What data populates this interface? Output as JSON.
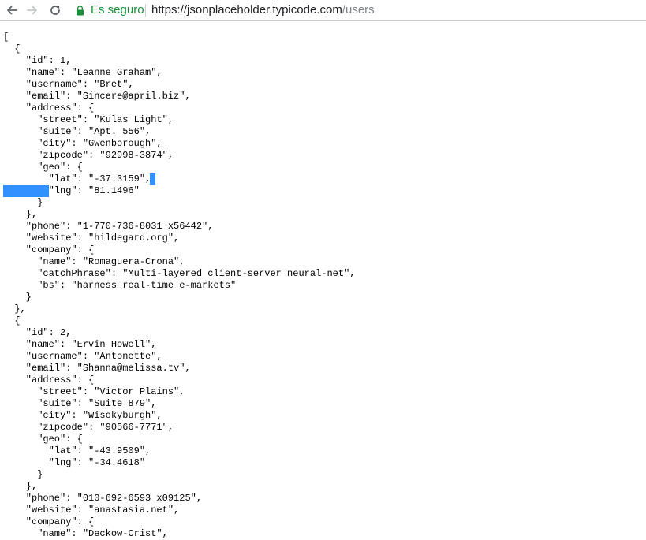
{
  "browser": {
    "security_label": "Es seguro",
    "url_scheme_host": "https://jsonplaceholder.typicode.com",
    "url_path": "/users",
    "colors": {
      "secure": "#1a8e3a",
      "selection": "#3390ff"
    },
    "icons": [
      "back-arrow-icon",
      "forward-arrow-icon",
      "reload-icon",
      "lock-icon"
    ]
  },
  "json_lines": [
    "[",
    "  {",
    "    \"id\": 1,",
    "    \"name\": \"Leanne Graham\",",
    "    \"username\": \"Bret\",",
    "    \"email\": \"Sincere@april.biz\",",
    "    \"address\": {",
    "      \"street\": \"Kulas Light\",",
    "      \"suite\": \"Apt. 556\",",
    "      \"city\": \"Gwenborough\",",
    "      \"zipcode\": \"92998-3874\",",
    "      \"geo\": {",
    "        \"lat\": \"-37.3159\",",
    "        \"lng\": \"81.1496\"",
    "      }",
    "    },",
    "    \"phone\": \"1-770-736-8031 x56442\",",
    "    \"website\": \"hildegard.org\",",
    "    \"company\": {",
    "      \"name\": \"Romaguera-Crona\",",
    "      \"catchPhrase\": \"Multi-layered client-server neural-net\",",
    "      \"bs\": \"harness real-time e-markets\"",
    "    }",
    "  },",
    "  {",
    "    \"id\": 2,",
    "    \"name\": \"Ervin Howell\",",
    "    \"username\": \"Antonette\",",
    "    \"email\": \"Shanna@melissa.tv\",",
    "    \"address\": {",
    "      \"street\": \"Victor Plains\",",
    "      \"suite\": \"Suite 879\",",
    "      \"city\": \"Wisokyburgh\",",
    "      \"zipcode\": \"90566-7771\",",
    "      \"geo\": {",
    "        \"lat\": \"-43.9509\",",
    "        \"lng\": \"-34.4618\"",
    "      }",
    "    },",
    "    \"phone\": \"010-692-6593 x09125\",",
    "    \"website\": \"anastasia.net\",",
    "    \"company\": {",
    "      \"name\": \"Deckow-Crist\","
  ]
}
